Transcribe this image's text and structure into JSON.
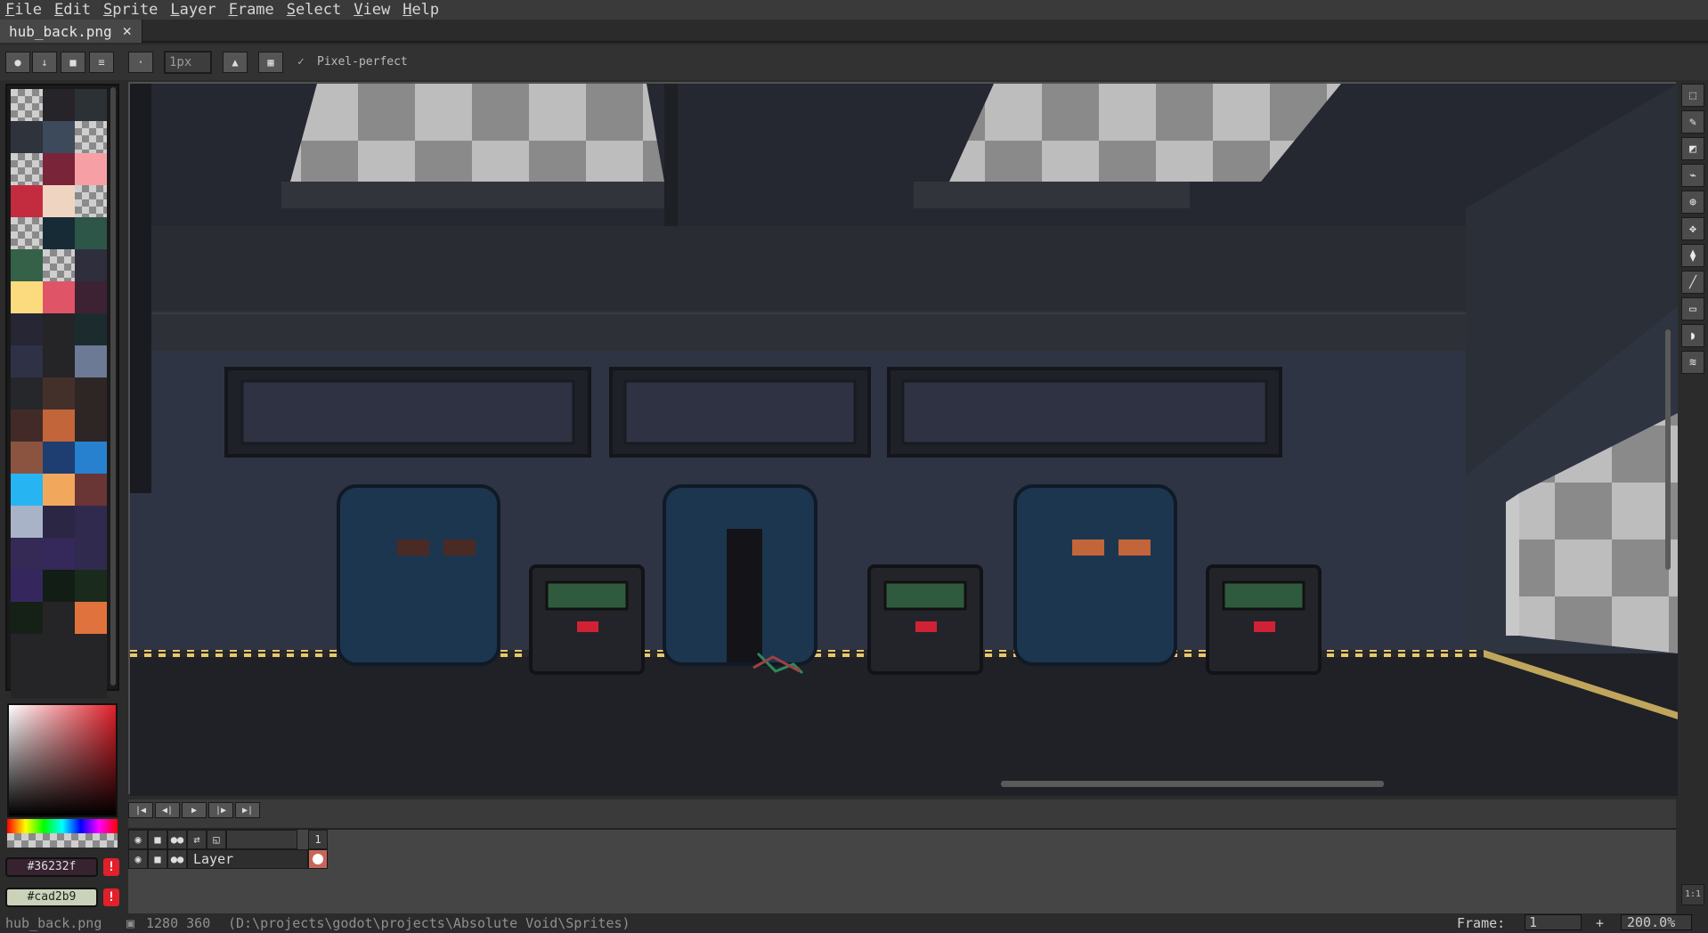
{
  "menu": [
    "File",
    "Edit",
    "Sprite",
    "Layer",
    "Frame",
    "Select",
    "View",
    "Help"
  ],
  "tab": {
    "title": "hub_back.png",
    "close": "✕"
  },
  "context": {
    "brush_size": "1px",
    "pixel_perfect_label": "Pixel-perfect",
    "pixel_perfect_checked": "✓"
  },
  "palette": {
    "colors": [
      "checker",
      "#262428",
      "#2c3136",
      "#2e333c",
      "#3d4a5c",
      "checker",
      "checker",
      "#7a2439",
      "#f6a0a6",
      "#c22c3e",
      "#efd5c1",
      "checker",
      "checker",
      "#172b36",
      "#2d5548",
      "#356148",
      "checker",
      "#2e2e3d",
      "#fbdb7e",
      "#e05468",
      "#3c2233",
      "#262635",
      "#252426",
      "#1c2b2e",
      "#2f3146",
      "#252426",
      "#6c7a95",
      "#25272a",
      "#44302b",
      "#2e2624",
      "#422a29",
      "#c2653b",
      "#2e2624",
      "#8a5441",
      "#1e3d71",
      "#2781cf",
      "#26b5f2",
      "#f1a85c",
      "#6a3535",
      "#a8b3c7",
      "#2a2643",
      "#302a4f",
      "#342a55",
      "#34295a",
      "#302a4f",
      "#35275e",
      "#121d16",
      "#1a2a1c",
      "#152017",
      "#252426",
      "#e0733d",
      "#252426",
      "#252426",
      "#252426",
      "#252426",
      "#252426",
      "#252426"
    ]
  },
  "colors": {
    "foreground": "#36232f",
    "background": "#cad2b9",
    "warning": "!"
  },
  "timeline": {
    "frame_number": "1",
    "layer_name": "Layer"
  },
  "status": {
    "file": "hub_back.png",
    "size": "1280 360",
    "path": "(D:\\projects\\godot\\projects\\Absolute Void\\Sprites)",
    "frame_label": "Frame:",
    "frame_value": "1",
    "zoom": "200.0%",
    "add": "+"
  },
  "tools": [
    "marquee-tool-icon",
    "pencil-tool-icon",
    "eraser-tool-icon",
    "eyedropper-tool-icon",
    "zoom-tool-icon",
    "move-tool-icon",
    "fill-tool-icon",
    "line-tool-icon",
    "rectangle-tool-icon",
    "blur-tool-icon",
    "contour-tool-icon"
  ]
}
